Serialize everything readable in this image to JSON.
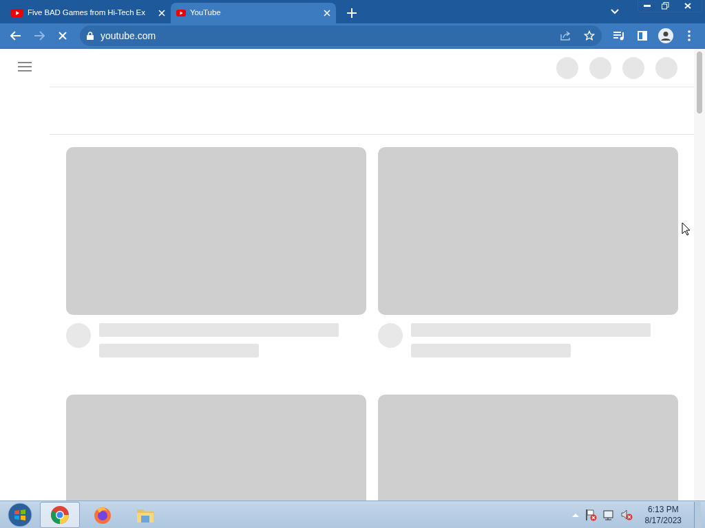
{
  "browser": {
    "tabs": [
      {
        "title": "Five BAD Games from Hi-Tech Ex",
        "selected": false
      },
      {
        "title": "YouTube",
        "selected": true
      }
    ],
    "address": "youtube.com",
    "loading": true
  },
  "taskbar": {
    "apps": [
      {
        "kind": "chrome",
        "selected": true
      },
      {
        "kind": "firefox",
        "selected": false
      },
      {
        "kind": "folder",
        "selected": false
      }
    ],
    "time": "6:13 PM",
    "date": "8/17/2023"
  }
}
